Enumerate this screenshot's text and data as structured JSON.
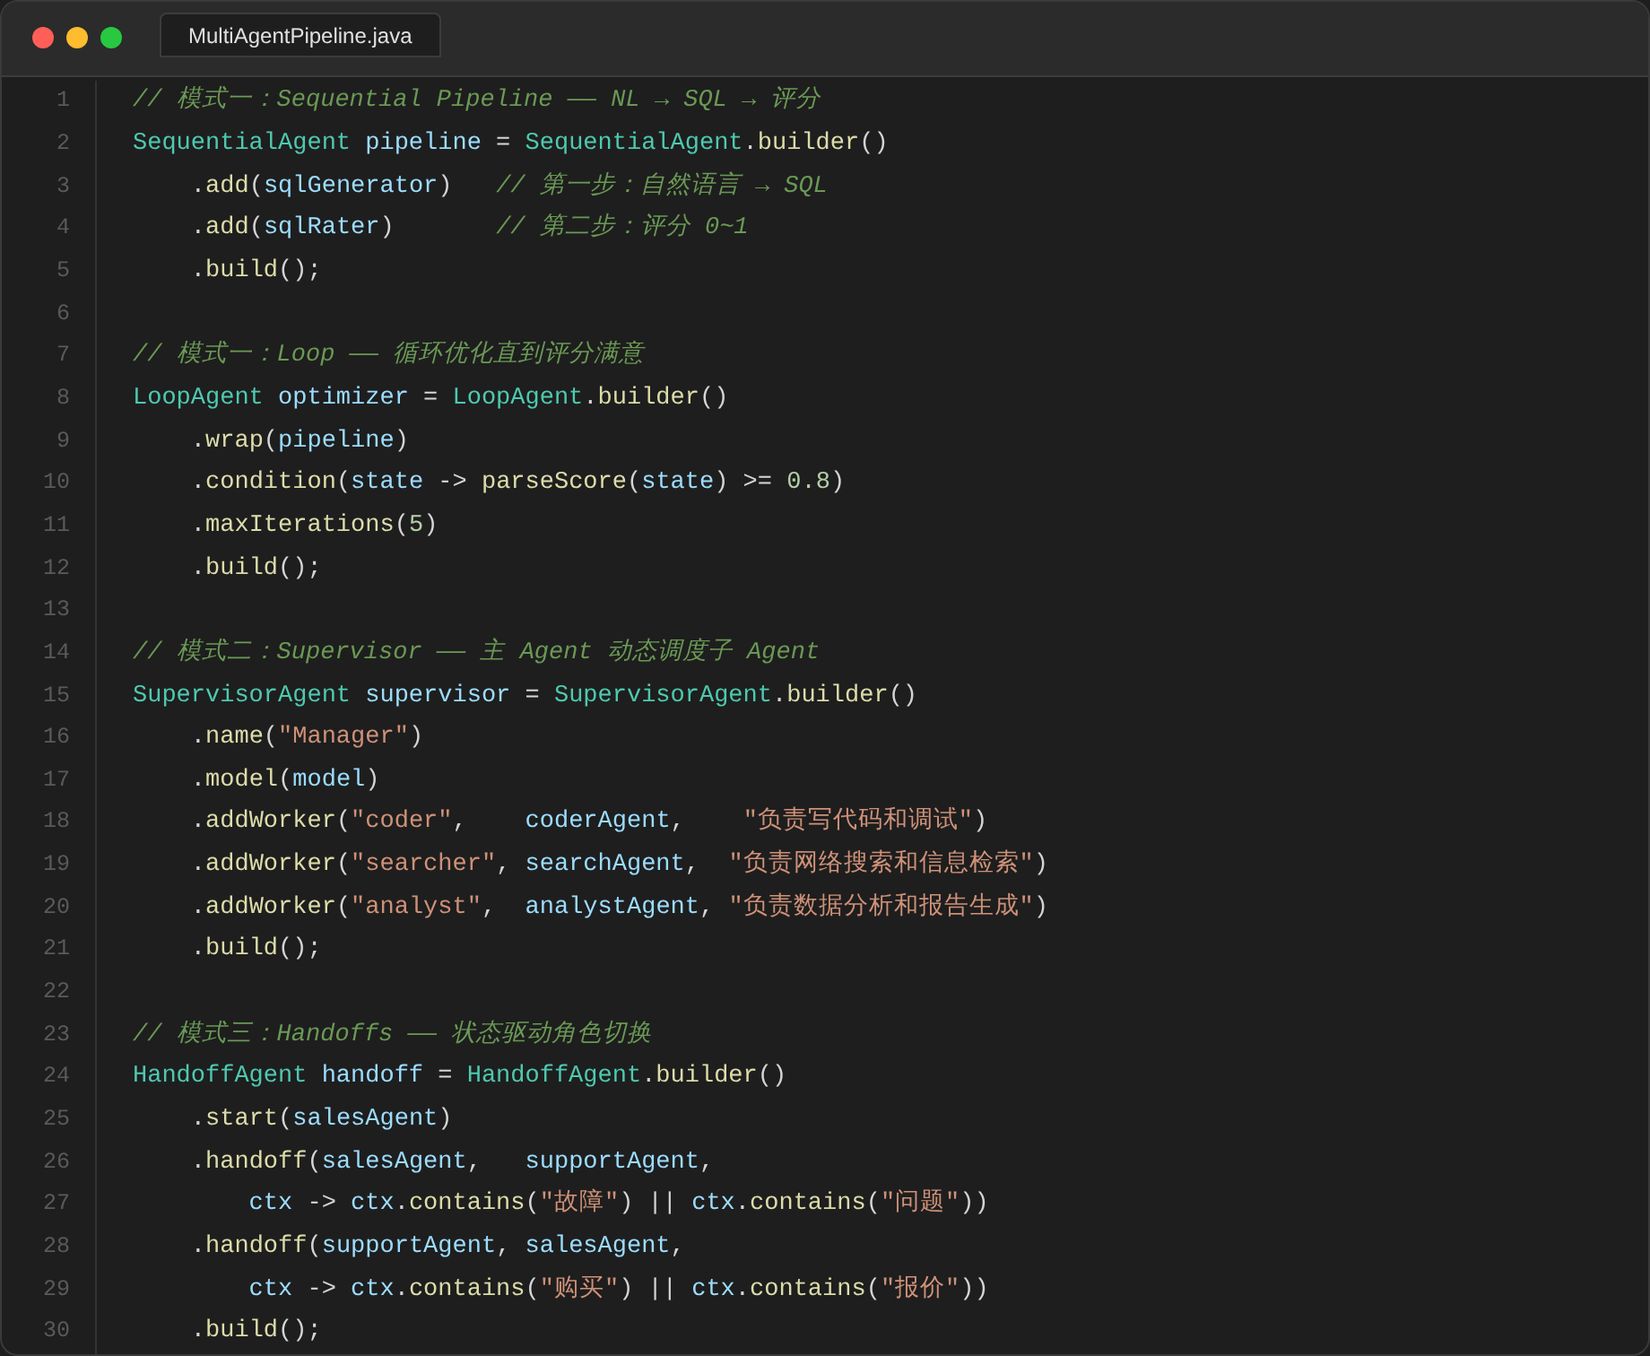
{
  "window": {
    "tab": {
      "title": "MultiAgentPipeline.java",
      "selected": true
    }
  },
  "editor": {
    "lines": [
      {
        "number": "1",
        "tokens": [
          {
            "kind": "comment",
            "text": "// 模式一：Sequential Pipeline —— NL → SQL → 评分"
          }
        ]
      },
      {
        "number": "2",
        "tokens": [
          {
            "kind": "type",
            "text": "SequentialAgent"
          },
          {
            "kind": "var",
            "text": " pipeline"
          },
          {
            "kind": "plain",
            "text": " = "
          },
          {
            "kind": "type",
            "text": "SequentialAgent"
          },
          {
            "kind": "plain",
            "text": "."
          },
          {
            "kind": "fn",
            "text": "builder"
          },
          {
            "kind": "plain",
            "text": "()"
          }
        ]
      },
      {
        "number": "3",
        "tokens": [
          {
            "kind": "plain",
            "text": "    ."
          },
          {
            "kind": "fn",
            "text": "add"
          },
          {
            "kind": "plain",
            "text": "("
          },
          {
            "kind": "var",
            "text": "sqlGenerator"
          },
          {
            "kind": "plain",
            "text": ")   "
          },
          {
            "kind": "comment",
            "text": "// 第一步：自然语言 → SQL"
          }
        ]
      },
      {
        "number": "4",
        "tokens": [
          {
            "kind": "plain",
            "text": "    ."
          },
          {
            "kind": "fn",
            "text": "add"
          },
          {
            "kind": "plain",
            "text": "("
          },
          {
            "kind": "var",
            "text": "sqlRater"
          },
          {
            "kind": "plain",
            "text": ")       "
          },
          {
            "kind": "comment",
            "text": "// 第二步：评分 0~1"
          }
        ]
      },
      {
        "number": "5",
        "tokens": [
          {
            "kind": "plain",
            "text": "    ."
          },
          {
            "kind": "fn",
            "text": "build"
          },
          {
            "kind": "plain",
            "text": "();"
          }
        ]
      },
      {
        "number": "6"
      },
      {
        "number": "7",
        "tokens": [
          {
            "kind": "comment",
            "text": "// 模式一：Loop —— 循环优化直到评分满意"
          }
        ]
      },
      {
        "number": "8",
        "tokens": [
          {
            "kind": "type",
            "text": "LoopAgent"
          },
          {
            "kind": "var",
            "text": " optimizer"
          },
          {
            "kind": "plain",
            "text": " = "
          },
          {
            "kind": "type",
            "text": "LoopAgent"
          },
          {
            "kind": "plain",
            "text": "."
          },
          {
            "kind": "fn",
            "text": "builder"
          },
          {
            "kind": "plain",
            "text": "()"
          }
        ]
      },
      {
        "number": "9",
        "tokens": [
          {
            "kind": "plain",
            "text": "    ."
          },
          {
            "kind": "fn",
            "text": "wrap"
          },
          {
            "kind": "plain",
            "text": "("
          },
          {
            "kind": "var",
            "text": "pipeline"
          },
          {
            "kind": "plain",
            "text": ")"
          }
        ]
      },
      {
        "number": "10",
        "tokens": [
          {
            "kind": "plain",
            "text": "    ."
          },
          {
            "kind": "fn",
            "text": "condition"
          },
          {
            "kind": "plain",
            "text": "("
          },
          {
            "kind": "var",
            "text": "state"
          },
          {
            "kind": "plain",
            "text": " -> "
          },
          {
            "kind": "fn",
            "text": "parseScore"
          },
          {
            "kind": "plain",
            "text": "("
          },
          {
            "kind": "var",
            "text": "state"
          },
          {
            "kind": "plain",
            "text": ") >= "
          },
          {
            "kind": "num",
            "text": "0.8"
          },
          {
            "kind": "plain",
            "text": ")"
          }
        ]
      },
      {
        "number": "11",
        "tokens": [
          {
            "kind": "plain",
            "text": "    ."
          },
          {
            "kind": "fn",
            "text": "maxIterations"
          },
          {
            "kind": "plain",
            "text": "("
          },
          {
            "kind": "num",
            "text": "5"
          },
          {
            "kind": "plain",
            "text": ")"
          }
        ]
      },
      {
        "number": "12",
        "tokens": [
          {
            "kind": "plain",
            "text": "    ."
          },
          {
            "kind": "fn",
            "text": "build"
          },
          {
            "kind": "plain",
            "text": "();"
          }
        ]
      },
      {
        "number": "13"
      },
      {
        "number": "14",
        "tokens": [
          {
            "kind": "comment",
            "text": "// 模式二：Supervisor —— 主 Agent 动态调度子 Agent"
          }
        ]
      },
      {
        "number": "15",
        "tokens": [
          {
            "kind": "type",
            "text": "SupervisorAgent"
          },
          {
            "kind": "var",
            "text": " supervisor"
          },
          {
            "kind": "plain",
            "text": " = "
          },
          {
            "kind": "type",
            "text": "SupervisorAgent"
          },
          {
            "kind": "plain",
            "text": "."
          },
          {
            "kind": "fn",
            "text": "builder"
          },
          {
            "kind": "plain",
            "text": "()"
          }
        ]
      },
      {
        "number": "16",
        "tokens": [
          {
            "kind": "plain",
            "text": "    ."
          },
          {
            "kind": "fn",
            "text": "name"
          },
          {
            "kind": "plain",
            "text": "("
          },
          {
            "kind": "str",
            "text": "\"Manager\""
          },
          {
            "kind": "plain",
            "text": ")"
          }
        ]
      },
      {
        "number": "17",
        "tokens": [
          {
            "kind": "plain",
            "text": "    ."
          },
          {
            "kind": "fn",
            "text": "model"
          },
          {
            "kind": "plain",
            "text": "("
          },
          {
            "kind": "var",
            "text": "model"
          },
          {
            "kind": "plain",
            "text": ")"
          }
        ]
      },
      {
        "number": "18",
        "tokens": [
          {
            "kind": "plain",
            "text": "    ."
          },
          {
            "kind": "fn",
            "text": "addWorker"
          },
          {
            "kind": "plain",
            "text": "("
          },
          {
            "kind": "str",
            "text": "\"coder\""
          },
          {
            "kind": "plain",
            "text": ",    "
          },
          {
            "kind": "var",
            "text": "coderAgent"
          },
          {
            "kind": "plain",
            "text": ",    "
          },
          {
            "kind": "str",
            "text": "\"负责写代码和调试\""
          },
          {
            "kind": "plain",
            "text": ")"
          }
        ]
      },
      {
        "number": "19",
        "tokens": [
          {
            "kind": "plain",
            "text": "    ."
          },
          {
            "kind": "fn",
            "text": "addWorker"
          },
          {
            "kind": "plain",
            "text": "("
          },
          {
            "kind": "str",
            "text": "\"searcher\""
          },
          {
            "kind": "plain",
            "text": ", "
          },
          {
            "kind": "var",
            "text": "searchAgent"
          },
          {
            "kind": "plain",
            "text": ",  "
          },
          {
            "kind": "str",
            "text": "\"负责网络搜索和信息检索\""
          },
          {
            "kind": "plain",
            "text": ")"
          }
        ]
      },
      {
        "number": "20",
        "tokens": [
          {
            "kind": "plain",
            "text": "    ."
          },
          {
            "kind": "fn",
            "text": "addWorker"
          },
          {
            "kind": "plain",
            "text": "("
          },
          {
            "kind": "str",
            "text": "\"analyst\""
          },
          {
            "kind": "plain",
            "text": ",  "
          },
          {
            "kind": "var",
            "text": "analystAgent"
          },
          {
            "kind": "plain",
            "text": ", "
          },
          {
            "kind": "str",
            "text": "\"负责数据分析和报告生成\""
          },
          {
            "kind": "plain",
            "text": ")"
          }
        ]
      },
      {
        "number": "21",
        "tokens": [
          {
            "kind": "plain",
            "text": "    ."
          },
          {
            "kind": "fn",
            "text": "build"
          },
          {
            "kind": "plain",
            "text": "();"
          }
        ]
      },
      {
        "number": "22"
      },
      {
        "number": "23",
        "tokens": [
          {
            "kind": "comment",
            "text": "// 模式三：Handoffs —— 状态驱动角色切换"
          }
        ]
      },
      {
        "number": "24",
        "tokens": [
          {
            "kind": "type",
            "text": "HandoffAgent"
          },
          {
            "kind": "var",
            "text": " handoff"
          },
          {
            "kind": "plain",
            "text": " = "
          },
          {
            "kind": "type",
            "text": "HandoffAgent"
          },
          {
            "kind": "plain",
            "text": "."
          },
          {
            "kind": "fn",
            "text": "builder"
          },
          {
            "kind": "plain",
            "text": "()"
          }
        ]
      },
      {
        "number": "25",
        "tokens": [
          {
            "kind": "plain",
            "text": "    ."
          },
          {
            "kind": "fn",
            "text": "start"
          },
          {
            "kind": "plain",
            "text": "("
          },
          {
            "kind": "var",
            "text": "salesAgent"
          },
          {
            "kind": "plain",
            "text": ")"
          }
        ]
      },
      {
        "number": "26",
        "tokens": [
          {
            "kind": "plain",
            "text": "    ."
          },
          {
            "kind": "fn",
            "text": "handoff"
          },
          {
            "kind": "plain",
            "text": "("
          },
          {
            "kind": "var",
            "text": "salesAgent"
          },
          {
            "kind": "plain",
            "text": ",   "
          },
          {
            "kind": "var",
            "text": "supportAgent"
          },
          {
            "kind": "plain",
            "text": ","
          }
        ]
      },
      {
        "number": "27",
        "tokens": [
          {
            "kind": "var",
            "text": "        ctx"
          },
          {
            "kind": "plain",
            "text": " -> "
          },
          {
            "kind": "var",
            "text": "ctx"
          },
          {
            "kind": "plain",
            "text": "."
          },
          {
            "kind": "fn",
            "text": "contains"
          },
          {
            "kind": "plain",
            "text": "("
          },
          {
            "kind": "str",
            "text": "\"故障\""
          },
          {
            "kind": "plain",
            "text": ") || "
          },
          {
            "kind": "var",
            "text": "ctx"
          },
          {
            "kind": "plain",
            "text": "."
          },
          {
            "kind": "fn",
            "text": "contains"
          },
          {
            "kind": "plain",
            "text": "("
          },
          {
            "kind": "str",
            "text": "\"问题\""
          },
          {
            "kind": "plain",
            "text": "))"
          }
        ]
      },
      {
        "number": "28",
        "tokens": [
          {
            "kind": "plain",
            "text": "    ."
          },
          {
            "kind": "fn",
            "text": "handoff"
          },
          {
            "kind": "plain",
            "text": "("
          },
          {
            "kind": "var",
            "text": "supportAgent"
          },
          {
            "kind": "plain",
            "text": ", "
          },
          {
            "kind": "var",
            "text": "salesAgent"
          },
          {
            "kind": "plain",
            "text": ","
          }
        ]
      },
      {
        "number": "29",
        "tokens": [
          {
            "kind": "var",
            "text": "        ctx"
          },
          {
            "kind": "plain",
            "text": " -> "
          },
          {
            "kind": "var",
            "text": "ctx"
          },
          {
            "kind": "plain",
            "text": "."
          },
          {
            "kind": "fn",
            "text": "contains"
          },
          {
            "kind": "plain",
            "text": "("
          },
          {
            "kind": "str",
            "text": "\"购买\""
          },
          {
            "kind": "plain",
            "text": ") || "
          },
          {
            "kind": "var",
            "text": "ctx"
          },
          {
            "kind": "plain",
            "text": "."
          },
          {
            "kind": "fn",
            "text": "contains"
          },
          {
            "kind": "plain",
            "text": "("
          },
          {
            "kind": "str",
            "text": "\"报价\""
          },
          {
            "kind": "plain",
            "text": "))"
          }
        ]
      },
      {
        "number": "30",
        "tokens": [
          {
            "kind": "plain",
            "text": "    ."
          },
          {
            "kind": "fn",
            "text": "build"
          },
          {
            "kind": "plain",
            "text": "();"
          }
        ]
      }
    ]
  }
}
